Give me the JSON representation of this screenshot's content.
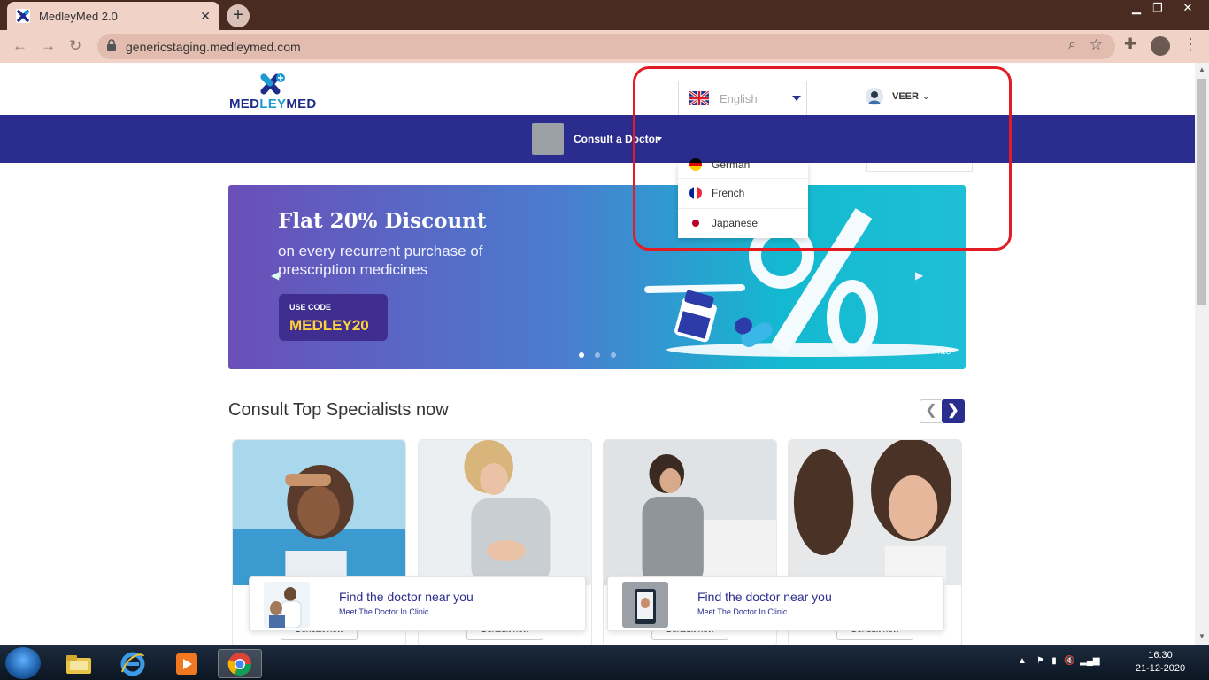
{
  "browser": {
    "tab_title": "MedleyMed 2.0",
    "tab_close": "✕",
    "new_tab": "+",
    "url": "genericstaging.medleymed.com",
    "window_controls": {
      "minimize": "▁",
      "maximize": "❐",
      "close": "✕"
    }
  },
  "header": {
    "logo_text_a": "MED",
    "logo_text_b": "LEY",
    "logo_text_c": "MED",
    "language": {
      "selected": "English"
    },
    "user": {
      "name": "VEER"
    }
  },
  "navbar": {
    "consult_label": "Consult a Doctor"
  },
  "language_dropdown": {
    "items": [
      {
        "label": "German",
        "flag": "german-flag"
      },
      {
        "label": "French",
        "flag": "french-flag"
      },
      {
        "label": "Japanese",
        "flag": "japanese-flag"
      }
    ]
  },
  "banner": {
    "headline": "Flat 20% Discount",
    "subtext": "on every recurrent purchase of prescription medicines",
    "code_label": "USE CODE",
    "code_value": "MEDLEY20",
    "terms": "*T&C",
    "active_slide": 1,
    "slide_count": 3
  },
  "specialists": {
    "title": "Consult Top Specialists now",
    "prev": "❮",
    "next": "❯",
    "cards": [
      {
        "button_label": "Consult now"
      },
      {
        "button_label": "Consult now"
      },
      {
        "button_label": "Consult now"
      },
      {
        "button_label": "Consult now"
      }
    ]
  },
  "find_doctor": [
    {
      "title": "Find the doctor near you",
      "subtitle": "Meet The Doctor In Clinic"
    },
    {
      "title": "Find the doctor near you",
      "subtitle": "Meet The Doctor In Clinic"
    }
  ],
  "taskbar": {
    "time": "16:30",
    "date": "21-12-2020"
  },
  "colors": {
    "brand_navy": "#2b2d8e",
    "brand_blue": "#1e9ad6",
    "highlight_red": "#e31b23",
    "code_yellow": "#ffd23c"
  }
}
